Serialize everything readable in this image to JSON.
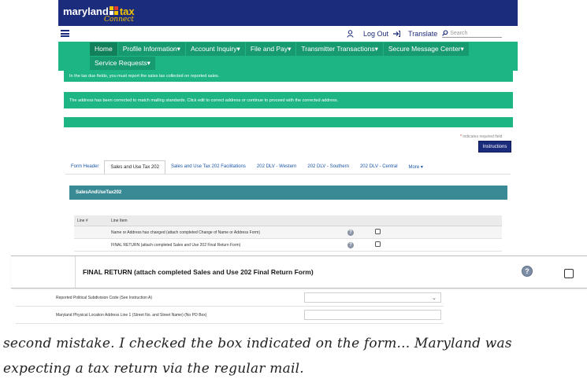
{
  "header": {
    "logo_maryland": "maryland",
    "logo_tax": "tax",
    "logo_connect": "Connect"
  },
  "util": {
    "logout_label": "Log Out",
    "translate_label": "Translate",
    "search_placeholder": "Search"
  },
  "nav": {
    "items": [
      {
        "label": "Home"
      },
      {
        "label": "Profile Information"
      },
      {
        "label": "Account Inquiry"
      },
      {
        "label": "File and Pay"
      },
      {
        "label": "Transmitter Transactions"
      },
      {
        "label": "Secure Message Center"
      },
      {
        "label": "Service Requests"
      }
    ]
  },
  "alerts": [
    "In the tax due fields, you must report the sales tax collected on reported sales.",
    "The address has been corrected to match mailing standards. Click edit to correct address or continue to proceed with the corrected address.",
    ""
  ],
  "form": {
    "required_note": "indicates required field",
    "instructions_button": "Instructions",
    "tabs": [
      "Form Header",
      "Sales and Use Tax 202",
      "Sales and Use Tax 202 Facilitations",
      "202 DLV - Western",
      "202 DLV - Southern",
      "202 DLV - Central",
      "More"
    ],
    "section_title": "SalesAndUseTax202",
    "table": {
      "headers": [
        "Line #",
        "Line Item"
      ],
      "rows": [
        {
          "item": "Name or Address has changed (attach completed Change of Name or Address Form)"
        },
        {
          "item": "FINAL RETURN (attach completed Sales and Use 202 Final Return Form)"
        }
      ]
    },
    "zoom_row_label": "FINAL RETURN (attach completed Sales and Use 202 Final Return Form)",
    "lower_rows": [
      {
        "label": "Reported Political Subdivision Code (See Instruction A)"
      },
      {
        "label": "Maryland Physical Location Address Line 1 (Street No. and Street Name) (No PO Box)"
      }
    ]
  },
  "caption": "second mistake. I checked the box indicated on the form... Maryland was expecting a tax return via the regular mail.",
  "colors": {
    "brand_navy": "#1c2c7c",
    "nav_green": "#1db584",
    "section_teal": "#3a8a96",
    "logo_gold": "#f2c300"
  }
}
